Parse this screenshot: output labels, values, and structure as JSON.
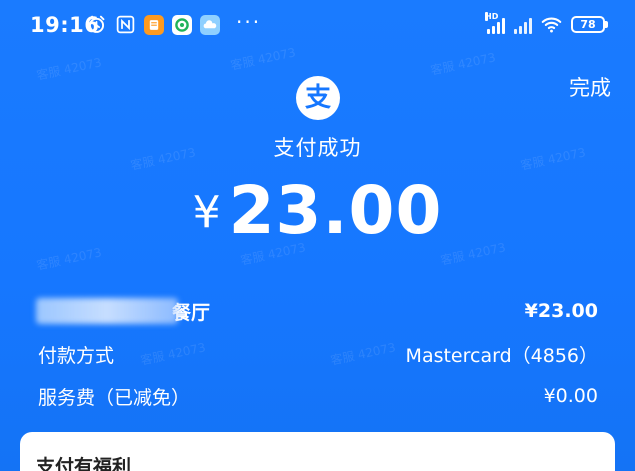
{
  "status_bar": {
    "time": "19:16",
    "battery": "78",
    "hd": "HD"
  },
  "header": {
    "done_label": "完成",
    "logo_char": "支"
  },
  "payment": {
    "title": "支付成功",
    "currency_symbol": "¥",
    "amount": "23.00"
  },
  "details": {
    "merchant_suffix": "餐厅",
    "merchant_amount": "¥23.00",
    "method_label": "付款方式",
    "method_value": "Mastercard（4856）",
    "fee_label": "服务费（已减免）",
    "fee_value": "¥0.00"
  },
  "benefits": {
    "title": "支付有福利"
  },
  "watermark": "客服 42073",
  "colors": {
    "background": "#1677ff",
    "card": "#ffffff"
  }
}
